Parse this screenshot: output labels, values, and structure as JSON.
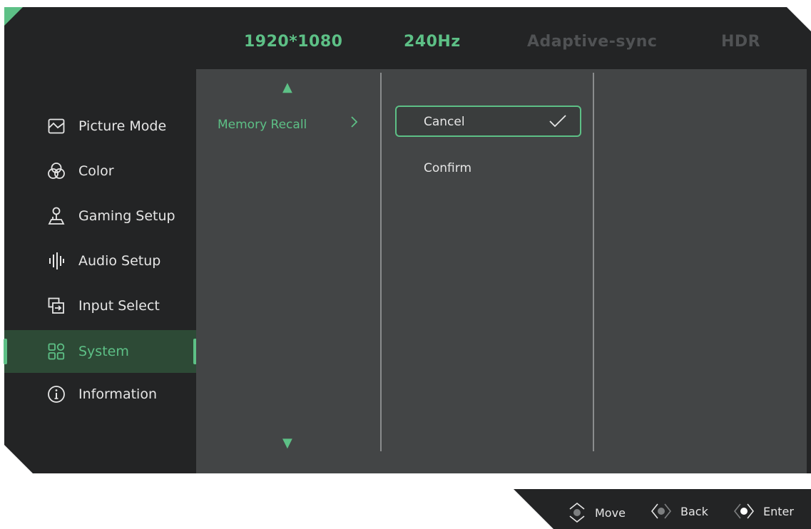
{
  "status": {
    "resolution": "1920*1080",
    "refresh": "240Hz",
    "adaptive_sync": "Adaptive-sync",
    "hdr": "HDR"
  },
  "sidebar": {
    "items": [
      {
        "label": "Picture Mode",
        "icon": "picture-icon"
      },
      {
        "label": "Color",
        "icon": "color-icon"
      },
      {
        "label": "Gaming Setup",
        "icon": "joystick-icon"
      },
      {
        "label": "Audio Setup",
        "icon": "audio-icon"
      },
      {
        "label": "Input Select",
        "icon": "input-icon"
      },
      {
        "label": "System",
        "icon": "grid-icon",
        "active": true
      },
      {
        "label": "Information",
        "icon": "info-icon"
      }
    ]
  },
  "submenu": {
    "label": "Memory Recall"
  },
  "options": {
    "cancel": "Cancel",
    "confirm": "Confirm"
  },
  "footer": {
    "move": "Move",
    "back": "Back",
    "enter": "Enter"
  },
  "colors": {
    "accent": "#5dc086",
    "panel": "#434546",
    "background": "#232425",
    "active_row": "#2d4a36"
  }
}
